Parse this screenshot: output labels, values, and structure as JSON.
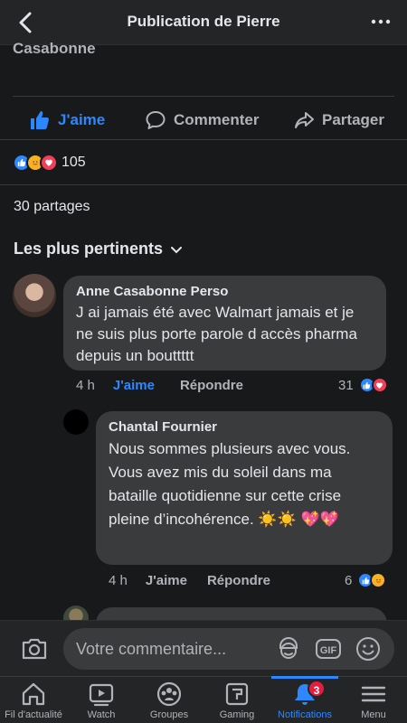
{
  "header": {
    "title": "Publication de Pierre"
  },
  "post": {
    "cut_author_fragment": "Casabonne",
    "actions": {
      "like": "J'aime",
      "comment": "Commenter",
      "share": "Partager"
    },
    "reaction_count": "105",
    "shares": "30 partages",
    "filter": "Les plus pertinents"
  },
  "comments": [
    {
      "author": "Anne Casabonne Perso",
      "text": "J ai jamais été avec Walmart jamais et je ne suis plus porte parole d accès pharma depuis un bouttttt",
      "time": "4 h",
      "like": "J'aime",
      "reply": "Répondre",
      "reactions": "31"
    },
    {
      "author": "Chantal Fournier",
      "text": "Nous sommes plusieurs avec vous. Vous avez mis du soleil dans ma bataille quotidienne sur cette crise pleine d’incohérence. ☀️☀️ 💖💖",
      "time": "4 h",
      "like": "J'aime",
      "reply": "Répondre",
      "reactions": "6"
    }
  ],
  "composer": {
    "placeholder": "Votre commentaire..."
  },
  "tabs": [
    {
      "label": "Fil d'actualité"
    },
    {
      "label": "Watch"
    },
    {
      "label": "Groupes"
    },
    {
      "label": "Gaming"
    },
    {
      "label": "Notifications",
      "badge": "3"
    },
    {
      "label": "Menu"
    }
  ],
  "colors": {
    "accent": "#2d88ff",
    "background": "#18191a",
    "surface": "#242526",
    "bubble": "#3a3b3c",
    "badge": "#e41e3f"
  }
}
